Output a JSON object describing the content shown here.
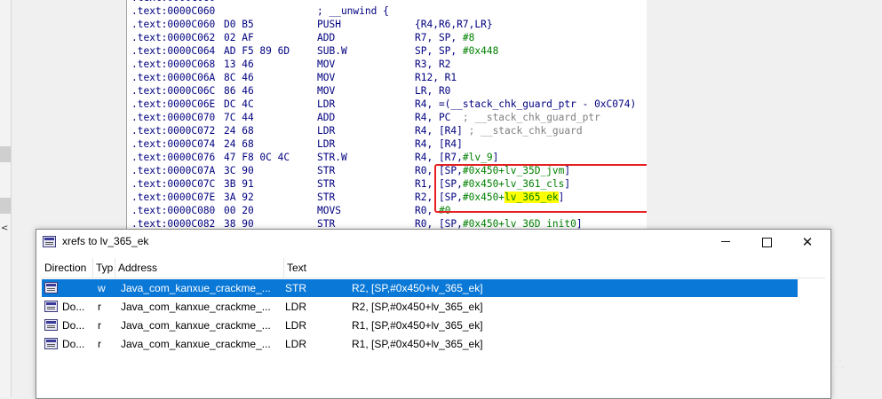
{
  "disassembly": {
    "lines": [
      {
        "addr": ".text:0000C060",
        "bytes": "",
        "mn": "",
        "ops": ""
      },
      {
        "addr": ".text:0000C060",
        "bytes": "",
        "mn": "; __unwind {",
        "ops": ""
      },
      {
        "addr": ".text:0000C060",
        "bytes": "D0 B5",
        "mn": "PUSH",
        "ops": "{R4,R6,R7,LR}"
      },
      {
        "addr": ".text:0000C062",
        "bytes": "02 AF",
        "mn": "ADD",
        "ops": "R7, SP, ",
        "num": "#8"
      },
      {
        "addr": ".text:0000C064",
        "bytes": "AD F5 89 6D",
        "mn": "SUB.W",
        "ops": "SP, SP, ",
        "num": "#0x448"
      },
      {
        "addr": ".text:0000C068",
        "bytes": "13 46",
        "mn": "MOV",
        "ops": "R3, R2"
      },
      {
        "addr": ".text:0000C06A",
        "bytes": "8C 46",
        "mn": "MOV",
        "ops": "R12, R1"
      },
      {
        "addr": ".text:0000C06C",
        "bytes": "86 46",
        "mn": "MOV",
        "ops": "LR, R0"
      },
      {
        "addr": ".text:0000C06E",
        "bytes": "DC 4C",
        "mn": "LDR",
        "ops": "R4, =(__stack_chk_guard_ptr - 0xC074)"
      },
      {
        "addr": ".text:0000C070",
        "bytes": "7C 44",
        "mn": "ADD",
        "ops": "R4, PC",
        "cmt": "  ; __stack_chk_guard_ptr"
      },
      {
        "addr": ".text:0000C072",
        "bytes": "24 68",
        "mn": "LDR",
        "ops": "R4, [R4]",
        "cmt": " ; __stack_chk_guard"
      },
      {
        "addr": ".text:0000C074",
        "bytes": "24 68",
        "mn": "LDR",
        "ops": "R4, [R4]"
      },
      {
        "addr": ".text:0000C076",
        "bytes": "47 F8 0C 4C",
        "mn": "STR.W",
        "ops": "R4, [R7,",
        "num": "#lv_9",
        "tail": "]"
      },
      {
        "addr": ".text:0000C07A",
        "bytes": "3C 90",
        "mn": "STR",
        "ops": "R0, [SP,",
        "num": "#0x450+lv_35D_jvm",
        "tail": "]"
      },
      {
        "addr": ".text:0000C07C",
        "bytes": "3B 91",
        "mn": "STR",
        "ops": "R1, [SP,",
        "num": "#0x450+lv_361_cls",
        "tail": "]"
      },
      {
        "addr": ".text:0000C07E",
        "bytes": "3A 92",
        "mn": "STR",
        "ops": "R2, [SP,",
        "num": "#0x450+",
        "hl": "lv_365_ek",
        "tail": "]"
      },
      {
        "addr": ".text:0000C080",
        "bytes": "00 20",
        "mn": "MOVS",
        "ops": "R0, ",
        "num": "#0"
      },
      {
        "addr": ".text:0000C082",
        "bytes": "38 90",
        "mn": "STR",
        "ops": "R0, [SP,",
        "num": "#0x450+lv_36D_init0",
        "tail": "]"
      }
    ]
  },
  "xrefs_window": {
    "title": "xrefs to lv_365_ek",
    "columns": [
      "Direction",
      "Typ",
      "Address",
      "Text"
    ],
    "rows": [
      {
        "direction": "",
        "type": "w",
        "address": "Java_com_kanxue_crackme_...",
        "mnemonic": "STR",
        "operands": "R2, [SP,#0x450+lv_365_ek]",
        "selected": true
      },
      {
        "direction": "Do...",
        "type": "r",
        "address": "Java_com_kanxue_crackme_...",
        "mnemonic": "LDR",
        "operands": "R2, [SP,#0x450+lv_365_ek]",
        "selected": false
      },
      {
        "direction": "Do...",
        "type": "r",
        "address": "Java_com_kanxue_crackme_...",
        "mnemonic": "LDR",
        "operands": "R1, [SP,#0x450+lv_365_ek]",
        "selected": false
      },
      {
        "direction": "Do...",
        "type": "r",
        "address": "Java_com_kanxue_crackme_...",
        "mnemonic": "LDR",
        "operands": "R1, [SP,#0x450+lv_365_ek]",
        "selected": false
      }
    ]
  },
  "icons": {
    "xref_icon": "xref-list-icon",
    "minimize": "minimize-icon",
    "maximize": "maximize-icon",
    "close": "close-icon"
  },
  "colors": {
    "selection": "#0a78d7",
    "code_blue": "#00007f",
    "code_green": "#008000",
    "highlight": "#ffff00",
    "annotation_box": "#e62020"
  }
}
